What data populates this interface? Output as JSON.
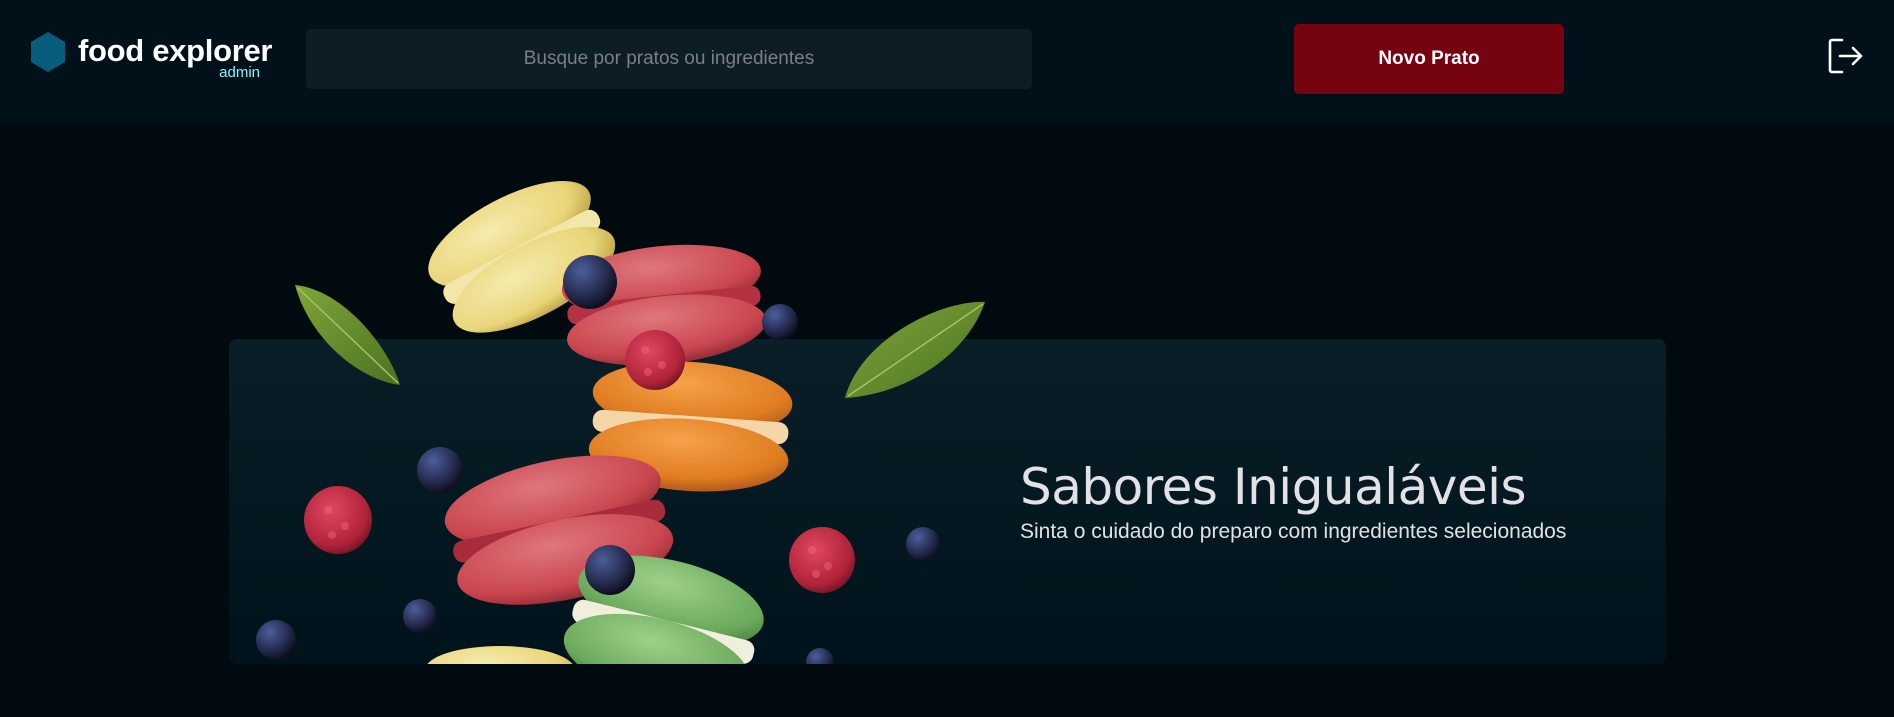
{
  "header": {
    "brand": {
      "name": "food explorer",
      "role": "admin",
      "logo_icon": "hexagon-logo-icon"
    },
    "search": {
      "placeholder": "Busque por pratos ou ingredientes",
      "value": "",
      "icon": "none"
    },
    "new_dish_button": {
      "label": "Novo Prato"
    },
    "logout": {
      "icon": "sign-out-icon"
    }
  },
  "banner": {
    "title": "Sabores Inigualáveis",
    "subtitle": "Sinta o cuidado do preparo com ingredientes selecionados",
    "image": "macarons-with-berries-illustration"
  },
  "colors": {
    "page_bg": "#000A0F",
    "header_bg": "#00111A",
    "accent_red": "#750310",
    "logo_blue": "#065E7C",
    "admin_cyan": "#82F3FF",
    "banner_bg": "#091E26"
  }
}
